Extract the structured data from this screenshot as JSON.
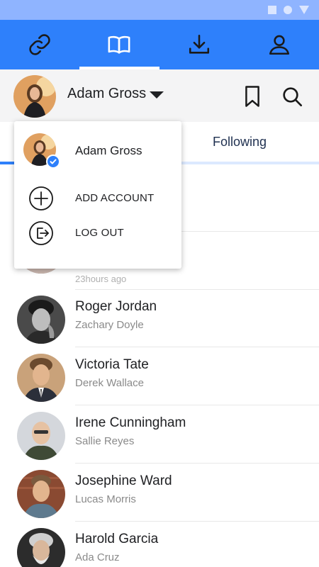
{
  "colors": {
    "primary": "#2e80fb",
    "status_bar": "#8fb4ff",
    "account_bar_bg": "#f4f4f5",
    "text_primary": "#202124",
    "text_secondary": "#8a8a8a"
  },
  "status_bar": {
    "icons": [
      "square-icon",
      "circle-icon",
      "triangle-icon"
    ]
  },
  "tabs": [
    {
      "icon": "link-icon",
      "active": false
    },
    {
      "icon": "book-icon",
      "active": true
    },
    {
      "icon": "download-icon",
      "active": false
    },
    {
      "icon": "profile-icon",
      "active": false
    }
  ],
  "account": {
    "name": "Adam Gross",
    "actions": [
      "bookmark-icon",
      "search-icon"
    ]
  },
  "section_tabs": {
    "visible_label": "Following"
  },
  "dropdown": {
    "current_account": "Adam Gross",
    "items": [
      {
        "icon": "add-circle-icon",
        "label": "ADD ACCOUNT"
      },
      {
        "icon": "logout-icon",
        "label": "LOG OUT"
      }
    ]
  },
  "partial_row": {
    "subtitle": "23hours ago"
  },
  "list": [
    {
      "name": "Roger Jordan",
      "subtitle": "Zachary Doyle"
    },
    {
      "name": "Victoria Tate",
      "subtitle": "Derek Wallace"
    },
    {
      "name": "Irene Cunningham",
      "subtitle": "Sallie Reyes"
    },
    {
      "name": "Josephine Ward",
      "subtitle": "Lucas Morris"
    },
    {
      "name": "Harold Garcia",
      "subtitle": "Ada Cruz"
    }
  ]
}
